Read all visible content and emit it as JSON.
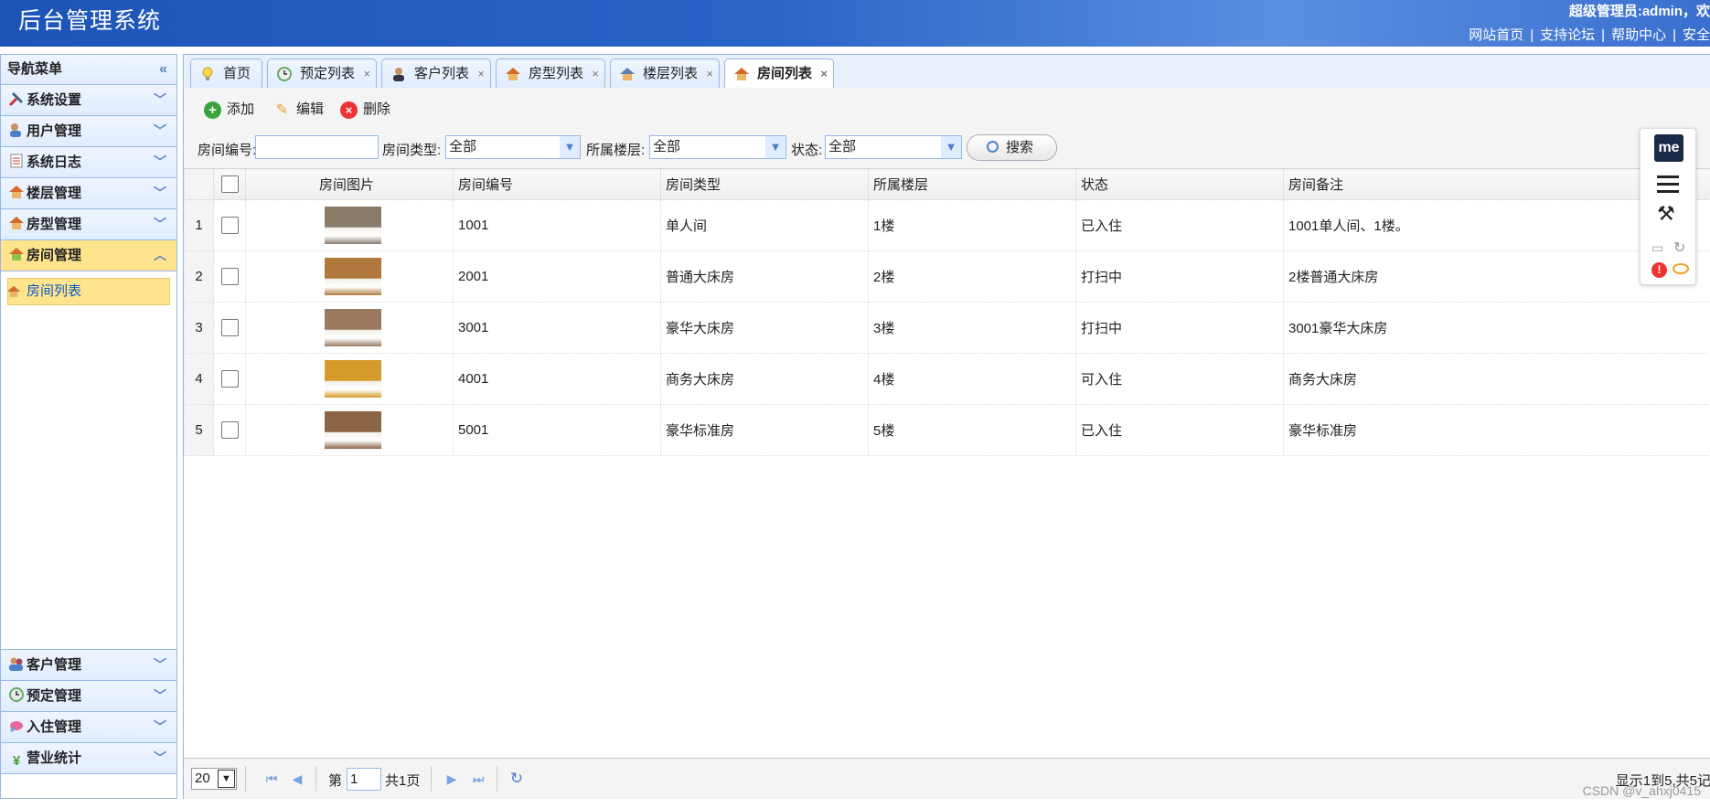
{
  "header": {
    "title": "后台管理系统",
    "welcome": "超级管理员:admin，欢",
    "links": [
      "网站首页",
      "支持论坛",
      "帮助中心",
      "安全"
    ]
  },
  "sidebar": {
    "title": "导航菜单",
    "top_items": [
      {
        "label": "系统设置",
        "icon": "tools-icon"
      },
      {
        "label": "用户管理",
        "icon": "users-icon"
      },
      {
        "label": "系统日志",
        "icon": "log-icon"
      },
      {
        "label": "楼层管理",
        "icon": "house-icon"
      },
      {
        "label": "房型管理",
        "icon": "house-icon"
      },
      {
        "label": "房间管理",
        "icon": "house-icon"
      }
    ],
    "active_sub_item": "房间列表",
    "bottom_items": [
      {
        "label": "客户管理",
        "icon": "customers-icon"
      },
      {
        "label": "预定管理",
        "icon": "clock-icon"
      },
      {
        "label": "入住管理",
        "icon": "checkin-icon"
      },
      {
        "label": "营业统计",
        "icon": "yen-icon"
      }
    ]
  },
  "tabs": [
    {
      "label": "首页",
      "closable": false
    },
    {
      "label": "预定列表",
      "closable": true
    },
    {
      "label": "客户列表",
      "closable": true
    },
    {
      "label": "房型列表",
      "closable": true
    },
    {
      "label": "楼层列表",
      "closable": true
    },
    {
      "label": "房间列表",
      "closable": true,
      "selected": true
    }
  ],
  "toolbar": {
    "add": "添加",
    "edit": "编辑",
    "delete": "删除"
  },
  "filters": {
    "room_no_label": "房间编号:",
    "room_no_value": "",
    "room_type_label": "房间类型:",
    "room_type_value": "全部",
    "floor_label": "所属楼层:",
    "floor_value": "全部",
    "status_label": "状态:",
    "status_value": "全部",
    "search": "搜索"
  },
  "grid": {
    "columns": [
      "房间图片",
      "房间编号",
      "房间类型",
      "所属楼层",
      "状态",
      "房间备注"
    ],
    "rows": [
      {
        "n": "1",
        "no": "1001",
        "type": "单人间",
        "floor": "1楼",
        "status": "已入住",
        "note": "1001单人间、1楼。",
        "img": "#8a7a6a"
      },
      {
        "n": "2",
        "no": "2001",
        "type": "普通大床房",
        "floor": "2楼",
        "status": "打扫中",
        "note": "2楼普通大床房",
        "img": "#b0783c"
      },
      {
        "n": "3",
        "no": "3001",
        "type": "豪华大床房",
        "floor": "3楼",
        "status": "打扫中",
        "note": "3001豪华大床房",
        "img": "#9a7a60"
      },
      {
        "n": "4",
        "no": "4001",
        "type": "商务大床房",
        "floor": "4楼",
        "status": "可入住",
        "note": "商务大床房",
        "img": "#d49a2a"
      },
      {
        "n": "5",
        "no": "5001",
        "type": "豪华标准房",
        "floor": "5楼",
        "status": "已入住",
        "note": "豪华标准房",
        "img": "#8c6446"
      }
    ]
  },
  "pager": {
    "page_size": "20",
    "page_prefix": "第",
    "page_value": "1",
    "page_total": "共1页",
    "info": "显示1到5,共5记"
  },
  "widget": {
    "logo": "me"
  },
  "watermark": "CSDN @v_ahxj0415"
}
